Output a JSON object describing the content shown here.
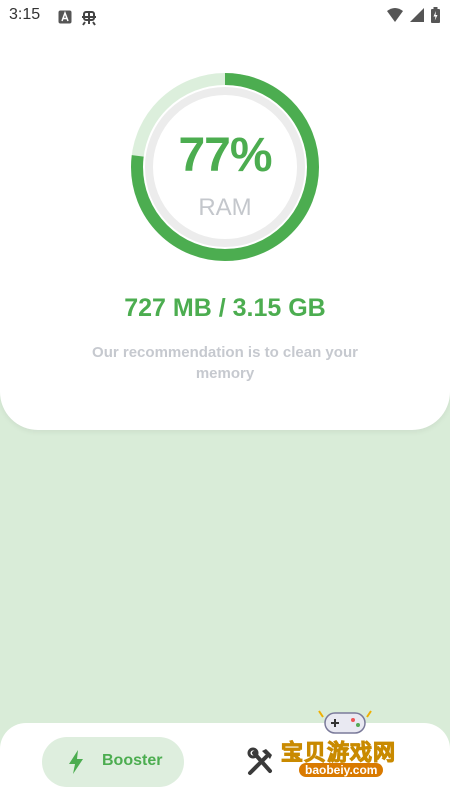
{
  "status_bar": {
    "time": "3:15",
    "left_icons": [
      "notification-a-icon",
      "bug-icon"
    ],
    "right_icons": [
      "wifi-icon",
      "signal-icon",
      "battery-icon"
    ]
  },
  "ram": {
    "percent_text": "77%",
    "percent_value": 0.77,
    "label": "RAM",
    "usage_text": "727 MB / 3.15 GB",
    "recommendation": "Our recommendation is to clean your memory"
  },
  "nav": {
    "booster_label": "Booster",
    "booster_icon": "lightning-bolt-icon",
    "tools_icon": "tools-icon"
  },
  "watermark": {
    "title": "宝贝游戏网",
    "url": "baobeiy.com"
  },
  "colors": {
    "accent": "#4cad50",
    "track": "#dcefdc",
    "background": "#d9ecd8",
    "muted_text": "#c6c9cf"
  }
}
